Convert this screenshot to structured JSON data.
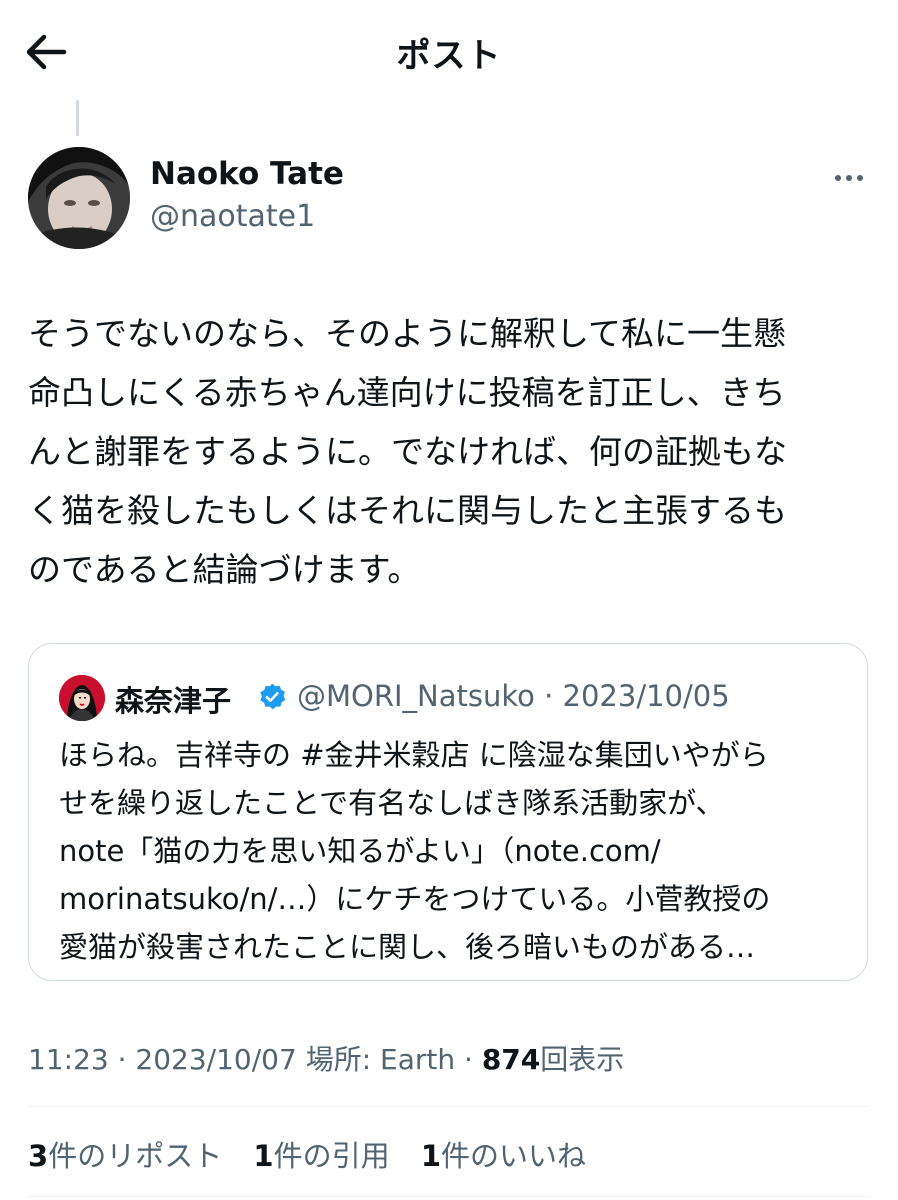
{
  "header": {
    "title": "ポスト"
  },
  "author": {
    "display_name": "Naoko Tate",
    "handle": "@naotate1"
  },
  "tweet": {
    "lines": [
      "そうでないのなら、そのように解釈して私に一生懸",
      "命凸しにくる赤ちゃん達向けに投稿を訂正し、きち",
      "んと謝罪をするように。でなければ、何の証拠もな",
      "く猫を殺したもしくはそれに関与したと主張するも",
      "のであると結論づけます。"
    ]
  },
  "quote": {
    "name": "森奈津子",
    "handle_date": "@MORI_Natsuko · 2023/10/05",
    "lines": [
      "ほらね。吉祥寺の #金井米穀店 に陰湿な集団いやがら",
      "せを繰り返したことで有名なしばき隊系活動家が、",
      "note「猫の力を思い知るがよい」（note.com/",
      "morinatsuko/n/…）にケチをつけている。小菅教授の",
      "愛猫が殺害されたことに関し、後ろ暗いものがある…"
    ]
  },
  "meta": {
    "time_date": "11:23 · 2023/10/07",
    "location": "場所: Earth ·",
    "views_count": "874",
    "views_label": "回表示"
  },
  "stats": {
    "reposts_count": "3",
    "reposts_label": "件のリポスト",
    "quotes_count": "1",
    "quotes_label": "件の引用",
    "likes_count": "1",
    "likes_label": "件のいいね"
  },
  "colors": {
    "text": "#0f1419",
    "secondary": "#536471",
    "border": "#cfd9de",
    "verified": "#1d9bf0"
  }
}
